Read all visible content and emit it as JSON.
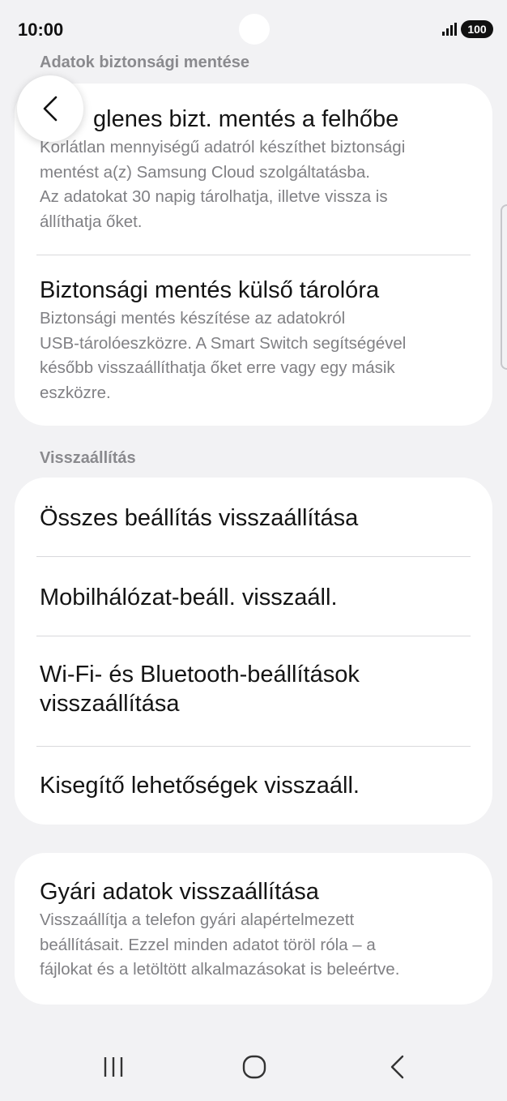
{
  "status_bar": {
    "time": "10:00",
    "battery": "100",
    "signal_icon": "signal-bars-icon"
  },
  "back_button": {
    "icon": "chevron-left-icon"
  },
  "sections": {
    "backup": {
      "header": "Adatok biztonsági mentése",
      "items": [
        {
          "title": "Ideiglenes bizt. mentés a felhőbe",
          "title_visible": "glenes bizt. mentés a felhőbe",
          "desc_lines": [
            "Korlátlan mennyiségű adatról készíthet biztonsági",
            "mentést a(z) Samsung Cloud szolgáltatásba.",
            "Az adatokat 30 napig tárolhatja, illetve vissza is",
            "állíthatja őket."
          ]
        },
        {
          "title": "Biztonsági mentés külső tárolóra",
          "desc_lines": [
            "Biztonsági mentés készítése az adatokról",
            "USB-tárolóeszközre. A Smart Switch segítségével",
            "később visszaállíthatja őket erre vagy egy másik",
            "eszközre."
          ]
        }
      ]
    },
    "reset": {
      "header": "Visszaállítás",
      "items": [
        {
          "title_lines": [
            "Összes beállítás visszaállítása"
          ]
        },
        {
          "title_lines": [
            "Mobilhálózat-beáll. visszaáll."
          ]
        },
        {
          "title_lines": [
            "Wi-Fi- és Bluetooth-beállítások",
            "visszaállítása"
          ]
        },
        {
          "title_lines": [
            "Kisegítő lehetőségek visszaáll."
          ]
        }
      ]
    },
    "factory": {
      "title": "Gyári adatok visszaállítása",
      "desc_lines": [
        "Visszaállítja a telefon gyári alapértelmezett",
        "beállításait. Ezzel minden adatot töröl róla – a",
        "fájlokat és a letöltött alkalmazásokat is beleértve."
      ]
    }
  },
  "nav_bar": {
    "recents_icon": "recent-apps-icon",
    "home_icon": "home-icon",
    "back_icon": "back-icon"
  },
  "colors": {
    "background": "#f2f2f4",
    "card": "#ffffff",
    "text_primary": "#141414",
    "text_secondary": "#808084",
    "divider": "#d9d9dc"
  }
}
